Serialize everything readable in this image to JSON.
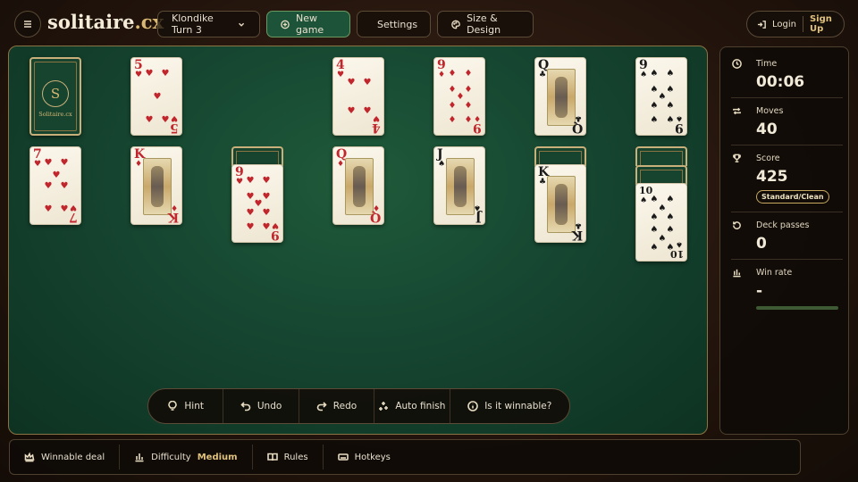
{
  "header": {
    "menu_icon": "hamburger-icon",
    "logo_main": "solitaire",
    "logo_tld": ".cx",
    "variant_label": "Klondike Turn 3",
    "new_game_label": "New game",
    "settings_label": "Settings",
    "size_design_label": "Size & Design",
    "login_label": "Login",
    "signup_label": "Sign Up"
  },
  "stock": {
    "brand": "Solitaire.cx",
    "monogram": "S"
  },
  "cards": {
    "waste": {
      "rank": "5",
      "suit": "♥"
    },
    "f1": {
      "rank": "4",
      "suit": "♥"
    },
    "f2": {
      "rank": "9",
      "suit": "♦"
    },
    "f3": {
      "rank": "Q",
      "suit": "♣"
    },
    "f4": {
      "rank": "9",
      "suit": "♠"
    },
    "t1": {
      "rank": "7",
      "suit": "♥"
    },
    "t2": {
      "rank": "K",
      "suit": "♦"
    },
    "t3": {
      "rank": "9",
      "suit": "♥"
    },
    "t4": {
      "rank": "Q",
      "suit": "♦"
    },
    "t5": {
      "rank": "J",
      "suit": "♠"
    },
    "t6": {
      "rank": "K",
      "suit": "♣"
    },
    "t7": {
      "rank": "10",
      "suit": "♠"
    }
  },
  "actions": {
    "hint": "Hint",
    "undo": "Undo",
    "redo": "Redo",
    "auto_finish": "Auto finish",
    "winnable": "Is it winnable?"
  },
  "stats": {
    "time_label": "Time",
    "time_value": "00:06",
    "moves_label": "Moves",
    "moves_value": "40",
    "score_label": "Score",
    "score_value": "425",
    "score_mode": "Standard/Clean",
    "passes_label": "Deck passes",
    "passes_value": "0",
    "winrate_label": "Win rate",
    "winrate_value": "-"
  },
  "footer": {
    "winnable_deal": "Winnable deal",
    "difficulty_label": "Difficulty",
    "difficulty_value": "Medium",
    "rules": "Rules",
    "hotkeys": "Hotkeys"
  },
  "colors": {
    "accent": "#d8b872",
    "table": "#154430",
    "primary_button": "#1e5a3a"
  }
}
